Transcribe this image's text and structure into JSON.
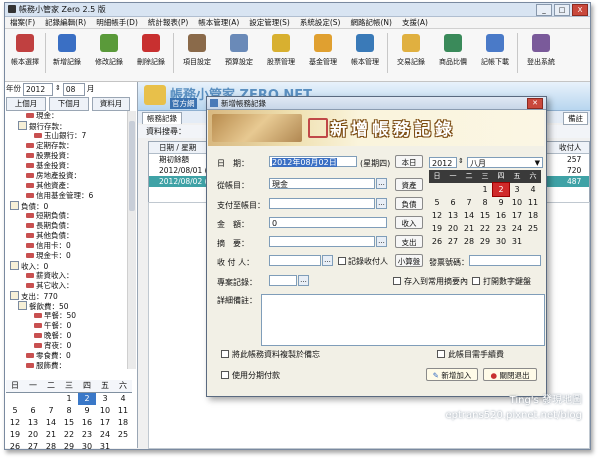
{
  "window": {
    "title": "帳務小管家 Zero 2.5 版",
    "controls": [
      "_",
      "□",
      "X"
    ]
  },
  "menu": [
    "檔案(F)",
    "記錄編輯(R)",
    "明細帳手(D)",
    "統計報表(P)",
    "帳本管理(A)",
    "設定管理(S)",
    "系統設定(S)",
    "網路記帳(N)",
    "支援(A)"
  ],
  "toolbar": [
    {
      "label": "帳本選擇",
      "icon": "ledger-select-icon",
      "color": "#c04040"
    },
    {
      "label": "新增記錄",
      "icon": "add-record-icon",
      "color": "#3a6fc4"
    },
    {
      "label": "修改記錄",
      "icon": "edit-record-icon",
      "color": "#5a9a3a"
    },
    {
      "label": "刪除記錄",
      "icon": "delete-record-icon",
      "color": "#c83030"
    },
    {
      "label": "項目設定",
      "icon": "item-settings-icon",
      "color": "#8a6a4a"
    },
    {
      "label": "預算設定",
      "icon": "budget-settings-icon",
      "color": "#6a8ab8"
    },
    {
      "label": "股票管理",
      "icon": "stock-icon",
      "color": "#d8b030"
    },
    {
      "label": "基金管理",
      "icon": "fund-icon",
      "color": "#e0a030"
    },
    {
      "label": "帳本管理",
      "icon": "monitor-icon",
      "color": "#3a7ab8"
    },
    {
      "label": "交易記錄",
      "icon": "pencil-icon",
      "color": "#e0b040"
    },
    {
      "label": "商品比價",
      "icon": "compare-icon",
      "color": "#3a8a5a"
    },
    {
      "label": "記帳下載",
      "icon": "download-icon",
      "color": "#4a7ac8"
    },
    {
      "label": "登出系統",
      "icon": "users-icon",
      "color": "#7a5a9a"
    }
  ],
  "left": {
    "year_label": "年份",
    "year": "2012",
    "month": "08",
    "month_suffix": "月",
    "buttons": [
      "上個月",
      "下個月",
      "資料月"
    ],
    "tree": [
      {
        "text": "現金：",
        "indent": 2,
        "type": "leaf"
      },
      {
        "text": "銀行存款：",
        "indent": 1,
        "type": "box"
      },
      {
        "text": "玉山銀行：7",
        "indent": 3,
        "type": "leaf"
      },
      {
        "text": "定期存款：",
        "indent": 2,
        "type": "leaf"
      },
      {
        "text": "股票投資：",
        "indent": 2,
        "type": "leaf"
      },
      {
        "text": "基金投資：",
        "indent": 2,
        "type": "leaf"
      },
      {
        "text": "房地產投資：",
        "indent": 2,
        "type": "leaf"
      },
      {
        "text": "其他資產：",
        "indent": 2,
        "type": "leaf"
      },
      {
        "text": "信用基金管理：6",
        "indent": 2,
        "type": "leaf"
      },
      {
        "text": "負債：0",
        "indent": 0,
        "type": "box"
      },
      {
        "text": "短期負債：",
        "indent": 2,
        "type": "leaf"
      },
      {
        "text": "長期負債：",
        "indent": 2,
        "type": "leaf"
      },
      {
        "text": "其他負債：",
        "indent": 2,
        "type": "leaf"
      },
      {
        "text": "信用卡：0",
        "indent": 2,
        "type": "leaf"
      },
      {
        "text": "現金卡：0",
        "indent": 2,
        "type": "leaf"
      },
      {
        "text": "收入：0",
        "indent": 0,
        "type": "box"
      },
      {
        "text": "薪資收入：",
        "indent": 2,
        "type": "leaf"
      },
      {
        "text": "其它收入：",
        "indent": 2,
        "type": "leaf"
      },
      {
        "text": "支出：770",
        "indent": 0,
        "type": "box"
      },
      {
        "text": "餐飲費：50",
        "indent": 1,
        "type": "box"
      },
      {
        "text": "早餐：50",
        "indent": 3,
        "type": "leaf"
      },
      {
        "text": "午餐：0",
        "indent": 3,
        "type": "leaf"
      },
      {
        "text": "晚餐：0",
        "indent": 3,
        "type": "leaf"
      },
      {
        "text": "宵夜：0",
        "indent": 3,
        "type": "leaf"
      },
      {
        "text": "零食費：0",
        "indent": 2,
        "type": "leaf"
      },
      {
        "text": "服飾費：",
        "indent": 2,
        "type": "leaf"
      }
    ],
    "calendar": {
      "weekdays": [
        "日",
        "一",
        "二",
        "三",
        "四",
        "五",
        "六"
      ],
      "days": [
        "",
        "",
        "",
        "1",
        "2",
        "3",
        "4",
        "5",
        "6",
        "7",
        "8",
        "9",
        "10",
        "11",
        "12",
        "13",
        "14",
        "15",
        "16",
        "17",
        "18",
        "19",
        "20",
        "21",
        "22",
        "23",
        "24",
        "25",
        "26",
        "27",
        "28",
        "29",
        "30",
        "31"
      ],
      "selected": "2"
    }
  },
  "banner": {
    "title": "帳務小管家 ZERO NET",
    "subtitle": "官方網"
  },
  "tabs": {
    "main": "帳務記錄",
    "right": "備註"
  },
  "query": {
    "label": "資料搜尋："
  },
  "table": {
    "headers": [
      "日期 / 星期",
      "",
      "收付人"
    ],
    "rows": [
      {
        "date": "期初餘額",
        "val": "257",
        "hl": false
      },
      {
        "date": "2012/08/01 (",
        "val": "720",
        "hl": false
      },
      {
        "date": "2012/08/02 (",
        "val": "487",
        "hl": true
      }
    ]
  },
  "dialog": {
    "title": "新增帳務記錄",
    "banner": "新增帳務記錄",
    "fields": {
      "date_label": "日　期：",
      "date_value": "2012年08月02日",
      "date_weekday": "(星期四)",
      "debit_label": "從帳目：",
      "debit_value": "現金",
      "credit_label": "支付至帳目：",
      "amount_label": "金　額：",
      "amount_value": "0",
      "summary_label": "摘　要：",
      "payee_label": "收 付 人：",
      "record_payee": "記錄收付人",
      "project_label": "專案記錄：",
      "invoice_label": "發票號碼：",
      "save_summary": "存入到常用摘要內",
      "open_keypad": "打開數字鍵盤",
      "memo_label": "詳細備註：",
      "copy_to_memo": "將此帳務資料複製於備忘",
      "handwriting": "此帳目需手續費",
      "use_installment": "使用分期付款"
    },
    "buttons": {
      "today": "本日",
      "asset": "資產",
      "liability": "負債",
      "income": "收入",
      "expense": "支出",
      "calculator": "小算盤",
      "add": "新增加入",
      "close": "關閉退出"
    },
    "calendar": {
      "year": "2012",
      "month": "八月",
      "weekdays": [
        "日",
        "一",
        "二",
        "三",
        "四",
        "五",
        "六"
      ],
      "days": [
        "",
        "",
        "",
        "1",
        "2",
        "3",
        "4",
        "5",
        "6",
        "7",
        "8",
        "9",
        "10",
        "11",
        "12",
        "13",
        "14",
        "15",
        "16",
        "17",
        "18",
        "19",
        "20",
        "21",
        "22",
        "23",
        "24",
        "25",
        "26",
        "27",
        "28",
        "29",
        "30",
        "31",
        "",
        "",
        "",
        "",
        "",
        "",
        "",
        ""
      ],
      "today": "2"
    }
  },
  "watermark": {
    "line1": "Ting's 發現地圖",
    "line2": "eptrans520.pixnet.net/blog"
  }
}
